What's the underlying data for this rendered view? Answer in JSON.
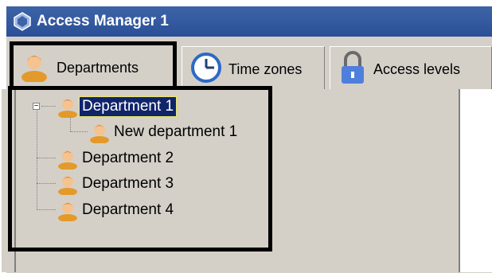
{
  "window": {
    "title": "Access Manager 1"
  },
  "tabs": [
    {
      "label": "Departments",
      "icon": "person-icon",
      "active": true
    },
    {
      "label": "Time zones",
      "icon": "clock-icon",
      "active": false
    },
    {
      "label": "Access levels",
      "icon": "lock-icon",
      "active": false
    }
  ],
  "tree": {
    "nodes": [
      {
        "label": "Department 1",
        "selected": true,
        "expanded": true,
        "icon": "person-icon"
      },
      {
        "label": "New department 1",
        "selected": false,
        "icon": "person-icon"
      },
      {
        "label": "Department 2",
        "selected": false,
        "icon": "person-icon"
      },
      {
        "label": "Department 3",
        "selected": false,
        "icon": "person-icon"
      },
      {
        "label": "Department 4",
        "selected": false,
        "icon": "person-icon"
      }
    ],
    "expander_symbol": "−"
  },
  "colors": {
    "titlebar": "#2a4f97",
    "selection": "#10246a",
    "panel": "#d4d0c8",
    "highlight_box": "#000000"
  }
}
